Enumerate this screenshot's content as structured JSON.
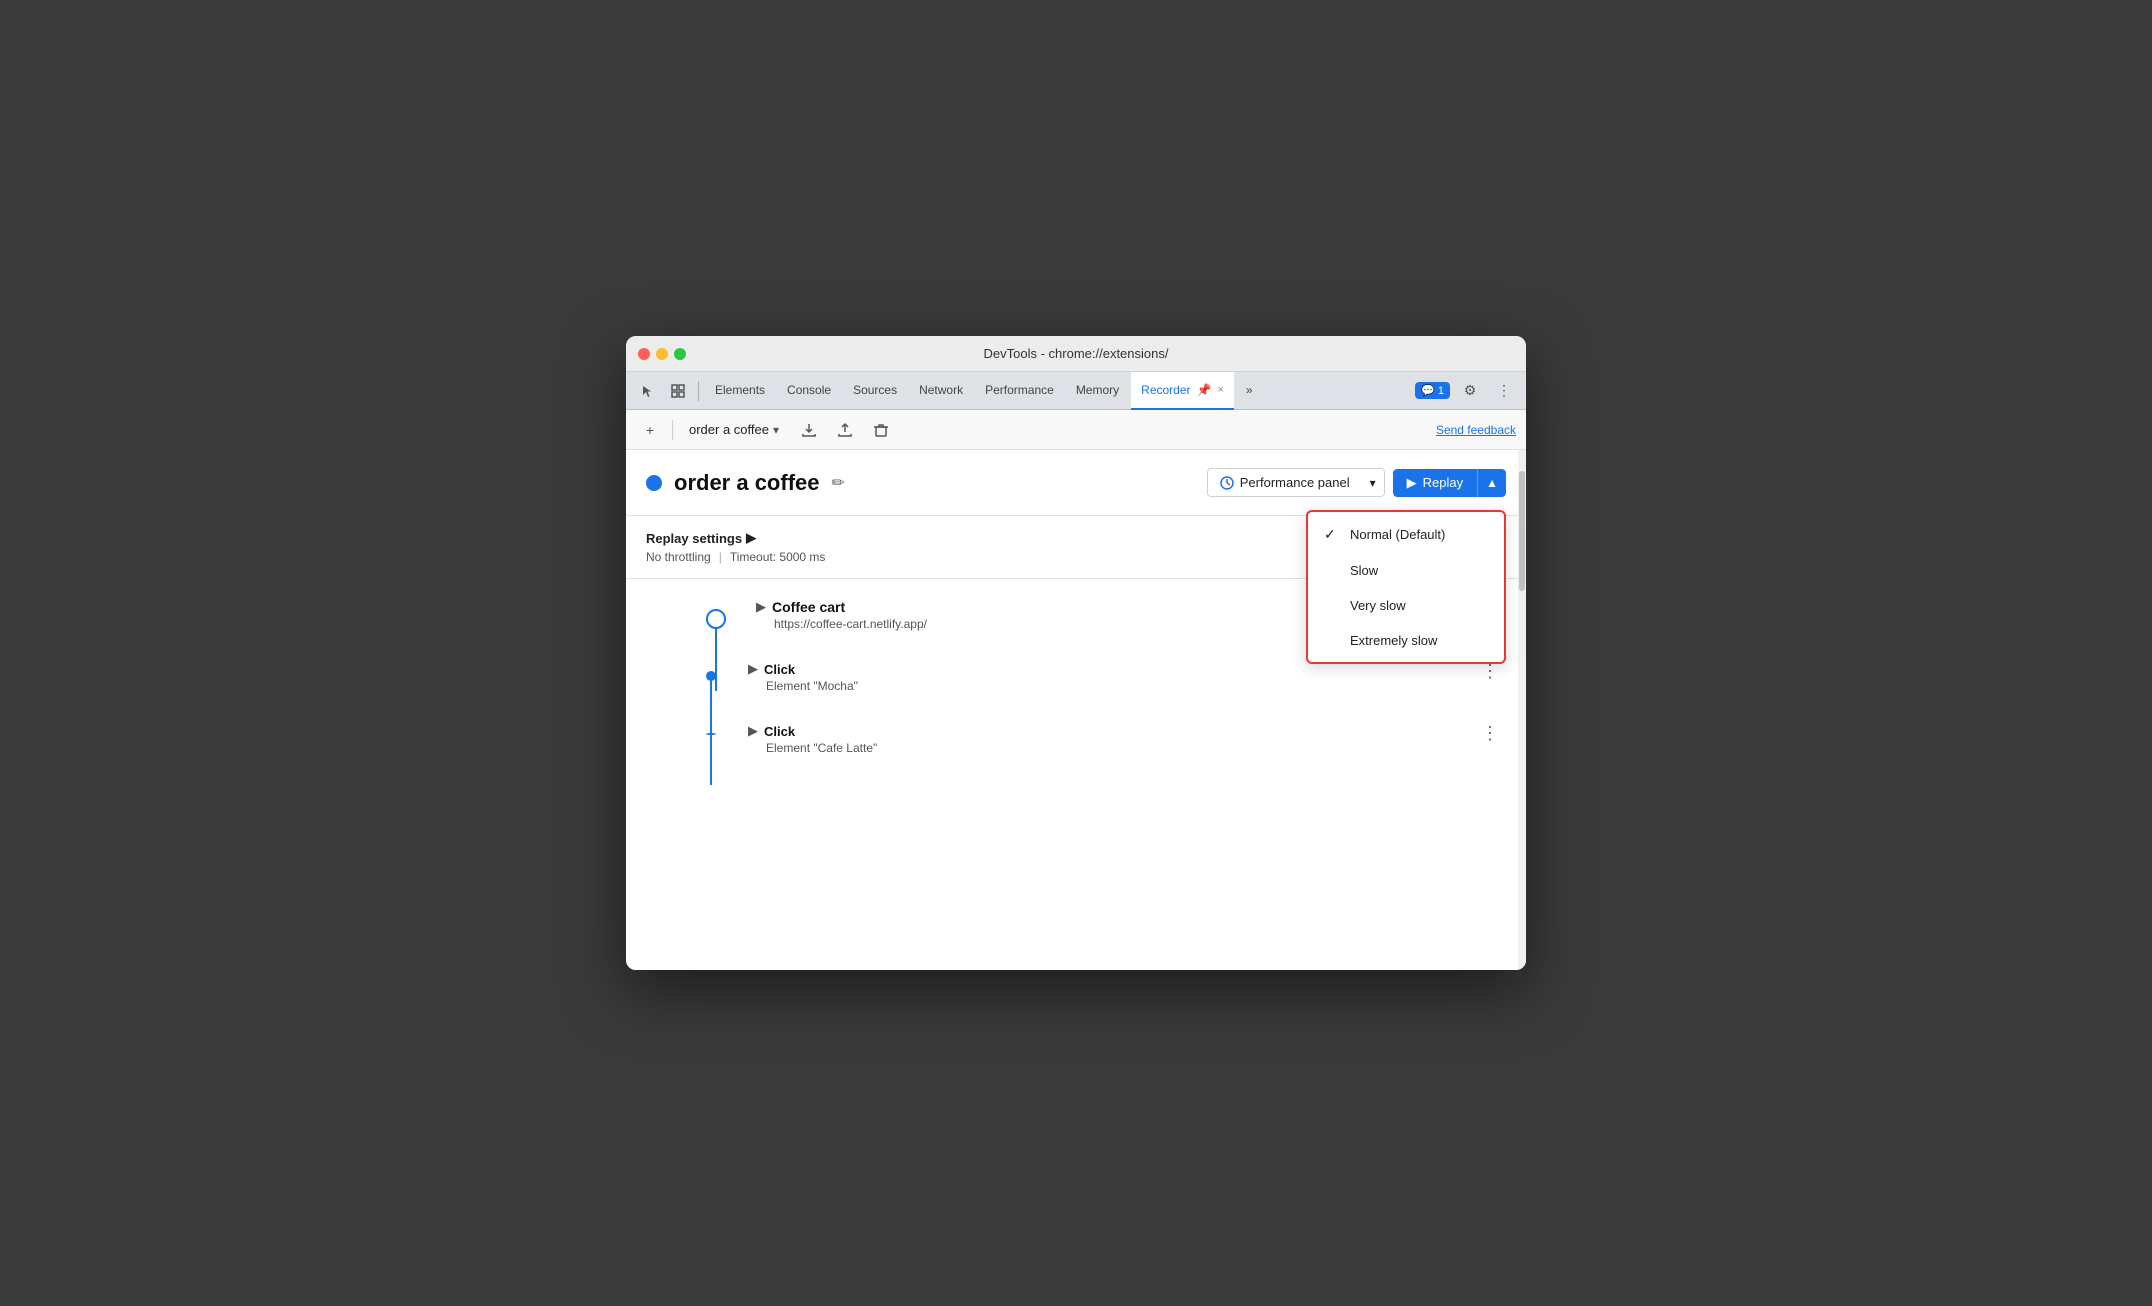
{
  "window": {
    "title": "DevTools - chrome://extensions/"
  },
  "tabs": {
    "items": [
      {
        "label": "Elements",
        "active": false
      },
      {
        "label": "Console",
        "active": false
      },
      {
        "label": "Sources",
        "active": false
      },
      {
        "label": "Network",
        "active": false
      },
      {
        "label": "Performance",
        "active": false
      },
      {
        "label": "Memory",
        "active": false
      },
      {
        "label": "Recorder",
        "active": true
      }
    ],
    "more_label": "»",
    "chat_badge": "1",
    "settings_icon": "⚙",
    "more_icon": "⋮"
  },
  "toolbar": {
    "plus_icon": "+",
    "recording_name": "order a coffee",
    "dropdown_icon": "▾",
    "upload_icon": "↑",
    "download_icon": "↓",
    "delete_icon": "🗑",
    "send_feedback": "Send feedback"
  },
  "recording": {
    "title": "order a coffee",
    "edit_icon": "✏",
    "perf_panel_label": "Performance panel",
    "dropdown_icon": "▾",
    "replay_label": "Replay",
    "replay_icon": "▶"
  },
  "replay_settings": {
    "title": "Replay settings",
    "arrow": "▶",
    "throttling": "No throttling",
    "timeout": "Timeout: 5000 ms"
  },
  "dropdown_menu": {
    "items": [
      {
        "label": "Normal (Default)",
        "checked": true
      },
      {
        "label": "Slow",
        "checked": false
      },
      {
        "label": "Very slow",
        "checked": false
      },
      {
        "label": "Extremely slow",
        "checked": false
      }
    ]
  },
  "steps": [
    {
      "type": "navigate",
      "title": "Coffee cart",
      "subtitle": "https://coffee-cart.netlify.app/",
      "has_outer_circle": true
    },
    {
      "type": "click",
      "title": "Click",
      "subtitle": "Element \"Mocha\"",
      "has_outer_circle": false
    },
    {
      "type": "click",
      "title": "Click",
      "subtitle": "Element \"Cafe Latte\"",
      "has_outer_circle": false
    }
  ],
  "colors": {
    "accent": "#1a73e8",
    "red_border": "#e53935"
  }
}
